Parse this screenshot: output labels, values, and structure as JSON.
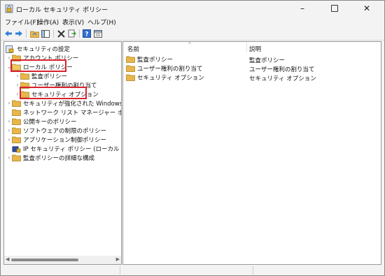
{
  "window": {
    "title": "ローカル セキュリティ ポリシー"
  },
  "menu": [
    "ファイル(F)",
    "操作(A)",
    "表示(V)",
    "ヘルプ(H)"
  ],
  "tree": {
    "root": "セキュリティの設定",
    "items": [
      {
        "label": "アカウント ポリシー"
      },
      {
        "label": "ローカル ポリシー"
      },
      {
        "label": "監査ポリシー"
      },
      {
        "label": "ユーザー権利の割り当て"
      },
      {
        "label": "セキュリティ オプション"
      },
      {
        "label": "セキュリティが強化された Windows Defen"
      },
      {
        "label": "ネットワーク リスト マネージャー ポリシー"
      },
      {
        "label": "公開キーのポリシー"
      },
      {
        "label": "ソフトウェアの制限のポリシー"
      },
      {
        "label": "アプリケーション制御ポリシー"
      },
      {
        "label": "IP セキュリティ ポリシー (ローカル コンピューター"
      },
      {
        "label": "監査ポリシーの詳細な構成"
      }
    ]
  },
  "list": {
    "columns": {
      "name": "名前",
      "desc": "説明"
    },
    "rows": [
      {
        "name": "監査ポリシー",
        "desc": "監査ポリシー"
      },
      {
        "name": "ユーザー権利の割り当て",
        "desc": "ユーザー権利の割り当て"
      },
      {
        "name": "セキュリティ オプション",
        "desc": "セキュリティ オプション"
      }
    ]
  },
  "colors": {
    "highlight": "#d9232e",
    "folder": "#e8b64a",
    "accent": "#1e6fd9"
  }
}
